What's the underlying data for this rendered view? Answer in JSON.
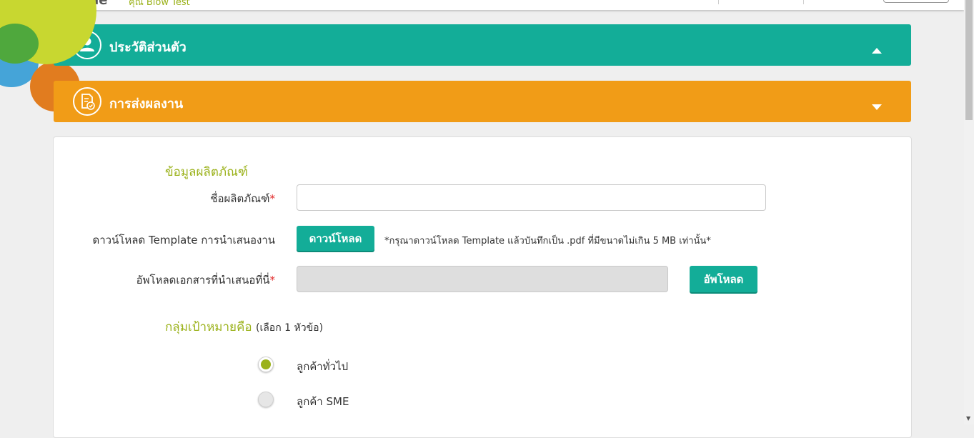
{
  "header": {
    "logo_text": "Mile",
    "user_name": "คุณ Blow Test"
  },
  "accordion": {
    "profile_title": "ประวัติส่วนตัว",
    "submit_title": "การส่งผลงาน"
  },
  "form": {
    "product_section_title": "ข้อมูลผลิตภัณฑ์",
    "product_name_label": "ชื่อผลิตภัณฑ์",
    "product_name_value": "",
    "required_mark": "*",
    "template_label": "ดาวน์โหลด Template การนำเสนองาน",
    "download_button": "ดาวน์โหลด",
    "template_note": "*กรุณาดาวน์โหลด Template แล้วบันทึกเป็น .pdf ที่มีขนาดไม่เกิน 5 MB เท่านั้น*",
    "upload_label": "อัพโหลดเอกสารที่นำเสนอที่นี่",
    "upload_value": "",
    "upload_button": "อัพโหลด",
    "target_section_title": "กลุ่มเป้าหมายคือ",
    "target_section_hint": "(เลือก 1 หัวข้อ)",
    "target_options": [
      {
        "label": "ลูกค้าทั่วไป",
        "checked": true
      },
      {
        "label": "ลูกค้า SME",
        "checked": false
      }
    ]
  },
  "colors": {
    "teal": "#13ad98",
    "orange": "#f19c17",
    "olive": "#9bb21b"
  }
}
